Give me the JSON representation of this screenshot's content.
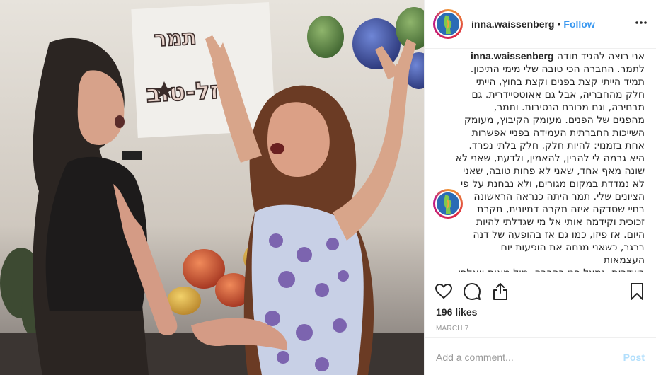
{
  "post": {
    "username": "inna.waissenberg",
    "dot": "•",
    "follow_label": "Follow",
    "more_label": "•••",
    "caption_user": "inna.waissenberg",
    "caption_text": "אני רוצה להגיד תודה\nלתמר. החברה הכי טובה שלי מימי התיכון.\nתמיד הייתי קצת בפנים וקצת בחוץ, הייתי\nחלק מהחבריה, אבל גם אאוטסיידרית. גם\nמבחירה, וגם מכורח הנסיבות. ותמר,\nמהפנים של הפנים. מעומק הקיבוץ, מעומק\nהשייכות החברתית העמידה בפניי אפשרות\nאחת בזמנוי: להיות חלק. חלק בלתי נפרד.\nהיא גרמה לי להבין, להאמין, ולדעת, שאני לא\nשונה מאף אחד, שאני לא פחות טובה, שאני\nלא נמדדת במקום מגורים, ולא נבחנת על פי\nהציונים שלי. תמר היתה כנראה הראשונה\nבחיי שסדקה איזה תקרה דמיונית, תקרת\nזכוכית וקידמה אותי אל מי שגדלתי להיות\nהיום. אז פיזו, כמו גם אז בהופעה של דנה\nברגר, כשאני מנחה את הופעות יום\nהעצמאות\nבשדרות, נמצל פני בהרבה, מול מאות וואלפי",
    "likes": "196 likes",
    "date": "MARCH 7",
    "comment_placeholder": "Add a comment...",
    "post_label": "Post"
  },
  "photo": {
    "banner_text": "תמר\nמזל-טוב"
  },
  "icons": {
    "like": "heart-icon",
    "comment": "comment-bubble-icon",
    "share": "share-icon",
    "save": "bookmark-icon"
  },
  "colors": {
    "link": "#3897f0",
    "post_disabled": "#b2dffc",
    "muted": "#999999",
    "border": "#efefef"
  }
}
